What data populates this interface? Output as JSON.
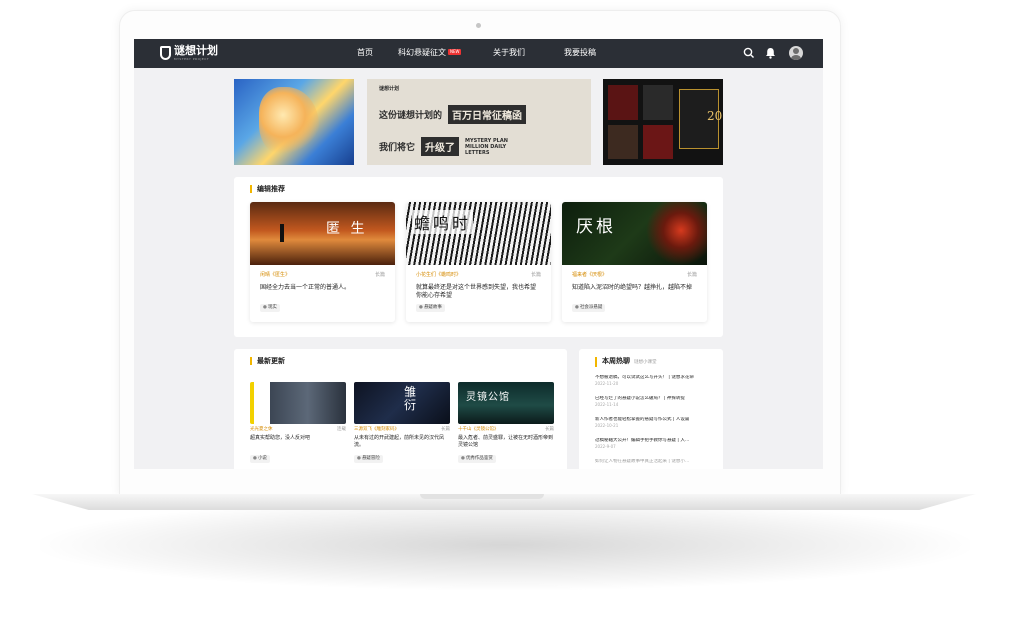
{
  "nav": {
    "logo_text": "谜想计划",
    "logo_sub": "MYSTERY PROJECT",
    "items": [
      "首页",
      "科幻悬疑征文",
      "关于我们",
      "我要投稿"
    ],
    "new_badge": "NEW"
  },
  "banners": {
    "mid": {
      "small_logo": "谜想计划",
      "line1": "这份谜想计划的",
      "line1_box": "百万日常征稿函",
      "line2": "我们将它",
      "line2_box": "升级了",
      "line2_en": "MYSTERY PLAN MILLION DAILY LETTERS"
    },
    "right_number": "20"
  },
  "editor_picks": {
    "title": "编辑推荐",
    "cards": [
      {
        "cover_title": "匿 生",
        "author_book": "闲晴《匿生》",
        "type": "长篇",
        "desc": "国经全力去当一个正常的普通人。",
        "tag": "现实"
      },
      {
        "cover_title": "蟾鸣时",
        "author_book": "小花生们《蟾鸣时》",
        "type": "长篇",
        "desc": "就算最终还是对这个世界感到失望，我也希望你能心存希望",
        "tag": "悬疑故事"
      },
      {
        "cover_title": "厌根",
        "author_book": "福来者《厌根》",
        "type": "长篇",
        "desc": "知道陷入泥沼时的绝望吗？越挣扎，越陷不掉",
        "tag": "社会派悬疑"
      }
    ]
  },
  "latest": {
    "title": "最新更新",
    "cards": [
      {
        "author_book": "光光夏之休",
        "type": "连载",
        "desc": "超真实帮助您，没人反对吧",
        "tag": "小说"
      },
      {
        "author_book": "三源双飞《雕刻家码》",
        "type": "长篇",
        "desc": "从未有过的开武建起，前所未见的汉代凤流。",
        "tag": "悬疑冒险"
      },
      {
        "author_book": "十千山《灵镜公馆》",
        "type": "长篇",
        "desc": "最入危者、前灵盛罪，让被在无时酒形帝到灵镜公馆",
        "tag": "优秀作品鉴赏"
      }
    ]
  },
  "weekly_hot": {
    "title": "本周热聊",
    "subtitle": "谜想小课堂",
    "items": [
      {
        "title": "不想被退稿，可以试试这么写开头！ | 谜想求花命",
        "date": "2022-11-20"
      },
      {
        "title": "已经写烂了的悬疑小说怎么破局？ | 神探转提",
        "date": "2022-11-14"
      },
      {
        "title": "新人作者也能轻松掌握的悬疑写作公式 | 人设篇",
        "date": "2022-10-21"
      },
      {
        "title": "过稿秘籍大公开！编辑手把手教你写悬疑 | 入…",
        "date": "2022-9-07"
      },
      {
        "title": "如何让人物在悬疑故事中真正活起来 | 谜想小…",
        "date": ""
      }
    ]
  },
  "colors": {
    "nav_bg": "#2b2f36",
    "accent": "#f2b600",
    "meta": "#d58a00",
    "page_bg": "#f1f1f3"
  }
}
